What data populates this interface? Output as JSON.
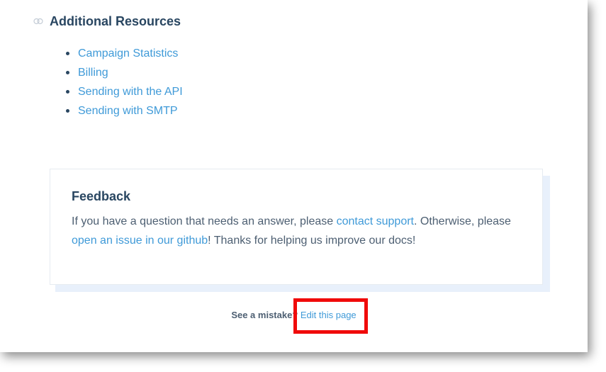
{
  "resources": {
    "title": "Additional Resources",
    "items": [
      {
        "label": "Campaign Statistics"
      },
      {
        "label": "Billing"
      },
      {
        "label": "Sending with the API"
      },
      {
        "label": "Sending with SMTP"
      }
    ]
  },
  "feedback": {
    "title": "Feedback",
    "text_1": "If you have a question that needs an answer, please ",
    "link_support": "contact support",
    "text_2": ". Otherwise, please ",
    "link_github": "open an issue in our github",
    "text_3": "! Thanks for helping us improve our docs!"
  },
  "footer": {
    "mistake_label": "See a mistake?",
    "edit_link": "Edit this page"
  },
  "colors": {
    "heading": "#294661",
    "link": "#3f9ad8",
    "body_text": "#4d5f72",
    "highlight": "#f00a0a",
    "card_shadow": "#e8f0fb"
  },
  "icons": {
    "section_icon": "link-icon"
  }
}
